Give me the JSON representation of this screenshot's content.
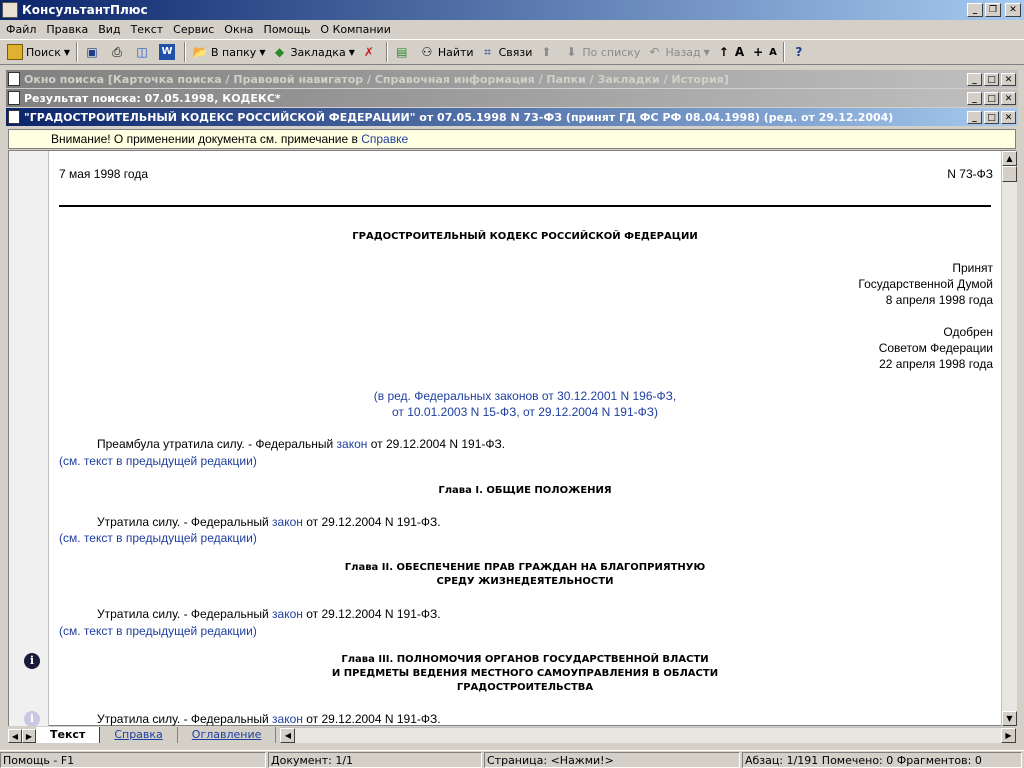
{
  "window": {
    "title": "КонсультантПлюс"
  },
  "menu": [
    "Файл",
    "Правка",
    "Вид",
    "Текст",
    "Сервис",
    "Окна",
    "Помощь",
    "О Компании"
  ],
  "toolbar": {
    "search": "Поиск",
    "to_folder": "В папку",
    "bookmark": "Закладка",
    "find": "Найти",
    "links": "Связи",
    "by_list": "По списку",
    "back": "Назад",
    "font_big": "A",
    "font_small": "A"
  },
  "subwindows": {
    "search_window": "Окно поиска [Карточка поиска / Правовой навигатор / Справочная информация / Папки / Закладки / История]",
    "search_result": "Результат поиска: 07.05.1998, КОДЕКС*",
    "document": "\"ГРАДОСТРОИТЕЛЬНЫЙ КОДЕКС РОССИЙСКОЙ ФЕДЕРАЦИИ\" от 07.05.1998 N 73-ФЗ (принят ГД ФС РФ 08.04.1998) (ред. от 29.12.2004)"
  },
  "notice": {
    "text": "Внимание! О применении документа см. примечание в ",
    "link": "Справке"
  },
  "doc": {
    "date": "7 мая 1998 года",
    "number": "N 73-ФЗ",
    "title": "ГРАДОСТРОИТЕЛЬНЫЙ КОДЕКС РОССИЙСКОЙ ФЕДЕРАЦИИ",
    "adopted": [
      "Принят",
      "Государственной Думой",
      "8 апреля 1998 года"
    ],
    "approved": [
      "Одобрен",
      "Советом Федерации",
      "22 апреля 1998 года"
    ],
    "edition_1": "(в ред. Федеральных законов от 30.12.2001 N 196-ФЗ,",
    "edition_2": "от 10.01.2003 N 15-ФЗ, от 29.12.2004 N 191-ФЗ)",
    "preamble_pre": "Преамбула утратила силу. - Федеральный ",
    "lost_pre": "Утратила силу. - Федеральный ",
    "law_word": "закон",
    "law_post": " от 29.12.2004 N 191-ФЗ.",
    "prev_edition": "(см. текст в предыдущей редакции)",
    "ch1": "Глава I. ОБЩИЕ ПОЛОЖЕНИЯ",
    "ch2_1": "Глава II. ОБЕСПЕЧЕНИЕ ПРАВ ГРАЖДАН НА БЛАГОПРИЯТНУЮ",
    "ch2_2": "СРЕДУ ЖИЗНЕДЕЯТЕЛЬНОСТИ",
    "ch3_1": "Глава III. ПОЛНОМОЧИЯ ОРГАНОВ ГОСУДАРСТВЕННОЙ ВЛАСТИ",
    "ch3_2": "И ПРЕДМЕТЫ ВЕДЕНИЯ МЕСТНОГО САМОУПРАВЛЕНИЯ В ОБЛАСТИ",
    "ch3_3": "ГРАДОСТРОИТЕЛЬСТВА"
  },
  "tabs": [
    "Текст",
    "Справка",
    "Оглавление"
  ],
  "status": {
    "help": "Помощь - F1",
    "document": "Документ: 1/1",
    "page": "Страница: <Нажми!>",
    "paragraph": "Абзац: 1/191",
    "marked": "Помечено: 0",
    "fragments": "Фрагментов: 0"
  }
}
